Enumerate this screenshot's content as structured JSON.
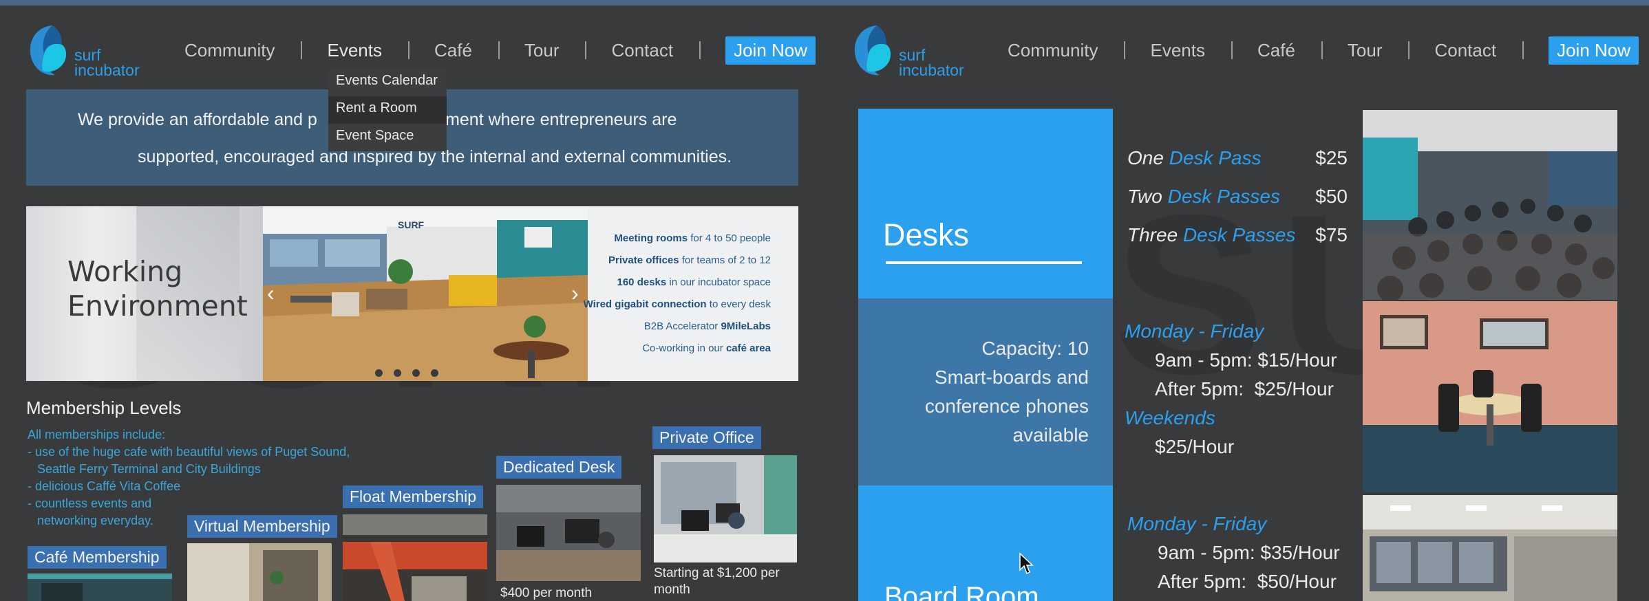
{
  "brand": {
    "word1": "surf",
    "word2": "incubator",
    "accent_color": "#2aa0ef"
  },
  "nav": {
    "items": [
      "Community",
      "Events",
      "Café",
      "Tour",
      "Contact"
    ],
    "join_label": "Join Now"
  },
  "events_dropdown": {
    "items": [
      "Events Calendar",
      "Rent a Room",
      "Event Space"
    ],
    "highlighted": "Rent a Room"
  },
  "mission": {
    "line1": "We provide an affordable and p",
    "line1b": "ronment where entrepreneurs are",
    "line2": "supported, encouraged and inspired by the internal and external communities."
  },
  "slider": {
    "heading_line1": "Working",
    "heading_line2": "Environment",
    "sign_text": "SURF",
    "features": [
      {
        "bold": "Meeting rooms",
        "rest": " for 4 to 50 people"
      },
      {
        "bold": "Private offices",
        "rest": " for teams of 2 to 12"
      },
      {
        "bold": "160 desks",
        "rest": " in our incubator space"
      },
      {
        "bold": "Wired gigabit connection",
        "rest": " to every desk"
      },
      {
        "bold": "9MileLabs",
        "rest": "B2B Accelerator "
      },
      {
        "bold": "café area",
        "rest": "Co-working in our "
      }
    ],
    "prev_icon": "chevron-left-icon",
    "next_icon": "chevron-right-icon"
  },
  "membership": {
    "title": "Membership Levels",
    "lines": [
      "All memberships include:",
      "- use of the huge cafe with beautiful views of Puget Sound,",
      "  Seattle Ferry Terminal and City Buildings",
      "- delicious Caffé Vita Coffee",
      "- countless events and",
      "  networking everyday."
    ],
    "tiers": [
      {
        "name": "Café Membership",
        "price": ""
      },
      {
        "name": "Virtual Membership",
        "price": ""
      },
      {
        "name": "Float Membership",
        "price": ""
      },
      {
        "name": "Dedicated Desk",
        "price": "$400 per month"
      },
      {
        "name": "Private Office",
        "price": "Starting at $1,200 per month"
      }
    ]
  },
  "rooms": {
    "desks_title": "Desks",
    "capacity_lines": [
      "Capacity: 10",
      "Smart-boards and",
      "conference phones",
      "available"
    ],
    "board_room_title": "Board Room",
    "passes": [
      {
        "qty": "One",
        "name": "Desk Pass",
        "price": "$25"
      },
      {
        "qty": "Two",
        "name": "Desk Passes",
        "price": "$50"
      },
      {
        "qty": "Three",
        "name": "Desk Passes",
        "price": "$75"
      }
    ],
    "schedule1": {
      "weekday_head": "Monday - Friday",
      "weekday_lines": [
        "9am - 5pm: $15/Hour",
        "After 5pm:  $25/Hour"
      ],
      "weekend_head": "Weekends",
      "weekend_lines": [
        "$25/Hour"
      ]
    },
    "schedule2": {
      "weekday_head": "Monday - Friday",
      "weekday_lines": [
        "9am - 5pm: $35/Hour",
        "After 5pm:  $50/Hour"
      ]
    }
  }
}
